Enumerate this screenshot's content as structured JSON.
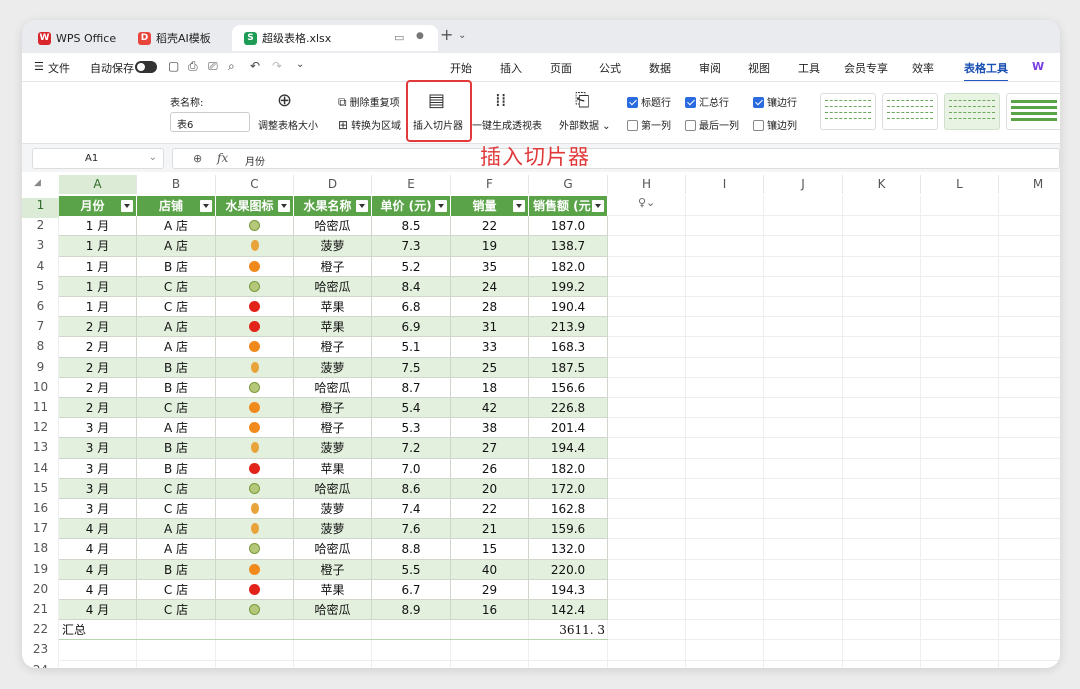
{
  "window_tabs": [
    {
      "label": "WPS Office",
      "icon": "wps-logo-icon",
      "color": "#d9262c"
    },
    {
      "label": "稻壳AI模板",
      "icon": "docer-logo-icon",
      "color": "#e8453c"
    },
    {
      "label": "超级表格.xlsx",
      "icon": "spreadsheet-icon",
      "color": "#1e9c56"
    }
  ],
  "menu": {
    "file": "文件",
    "autosave": "自动保存",
    "tabs": [
      "开始",
      "插入",
      "页面",
      "公式",
      "数据",
      "审阅",
      "视图",
      "工具",
      "会员专享",
      "效率",
      "表格工具",
      "W"
    ]
  },
  "ribbon": {
    "table_name_label": "表名称:",
    "table_name_value": "表6",
    "resize_table": "调整表格大小",
    "remove_duplicates": "删除重复项",
    "convert_to_range": "转换为区域",
    "insert_slicer": "插入切片器",
    "pivot": "一键生成透视表",
    "external_data": "外部数据",
    "options": {
      "header_row": "标题行",
      "total_row": "汇总行",
      "banded_rows": "镶边行",
      "first_col": "第一列",
      "last_col": "最后一列",
      "banded_cols": "镶边列"
    }
  },
  "formula_bar": {
    "cell_ref": "A1",
    "fx": "fx",
    "content": "月份"
  },
  "callout": "插入切片器",
  "columns": [
    "A",
    "B",
    "C",
    "D",
    "E",
    "F",
    "G",
    "H",
    "I",
    "J",
    "K",
    "L",
    "M"
  ],
  "headers": [
    "月份",
    "店铺",
    "水果图标",
    "水果名称",
    "单价 (元)",
    "销量",
    "销售额 (元)"
  ],
  "rows": [
    {
      "month": "1 月",
      "store": "A 店",
      "fruit_icon": "melon",
      "fruit": "哈密瓜",
      "price": "8.5",
      "qty": "22",
      "sales": "187.0"
    },
    {
      "month": "1 月",
      "store": "A 店",
      "fruit_icon": "pineapple",
      "fruit": "菠萝",
      "price": "7.3",
      "qty": "19",
      "sales": "138.7"
    },
    {
      "month": "1 月",
      "store": "B 店",
      "fruit_icon": "orange",
      "fruit": "橙子",
      "price": "5.2",
      "qty": "35",
      "sales": "182.0"
    },
    {
      "month": "1 月",
      "store": "C 店",
      "fruit_icon": "melon",
      "fruit": "哈密瓜",
      "price": "8.4",
      "qty": "24",
      "sales": "199.2"
    },
    {
      "month": "1 月",
      "store": "C 店",
      "fruit_icon": "apple",
      "fruit": "苹果",
      "price": "6.8",
      "qty": "28",
      "sales": "190.4"
    },
    {
      "month": "2 月",
      "store": "A 店",
      "fruit_icon": "apple",
      "fruit": "苹果",
      "price": "6.9",
      "qty": "31",
      "sales": "213.9"
    },
    {
      "month": "2 月",
      "store": "A 店",
      "fruit_icon": "orange",
      "fruit": "橙子",
      "price": "5.1",
      "qty": "33",
      "sales": "168.3"
    },
    {
      "month": "2 月",
      "store": "B 店",
      "fruit_icon": "pineapple",
      "fruit": "菠萝",
      "price": "7.5",
      "qty": "25",
      "sales": "187.5"
    },
    {
      "month": "2 月",
      "store": "B 店",
      "fruit_icon": "melon",
      "fruit": "哈密瓜",
      "price": "8.7",
      "qty": "18",
      "sales": "156.6"
    },
    {
      "month": "2 月",
      "store": "C 店",
      "fruit_icon": "orange",
      "fruit": "橙子",
      "price": "5.4",
      "qty": "42",
      "sales": "226.8"
    },
    {
      "month": "3 月",
      "store": "A 店",
      "fruit_icon": "orange",
      "fruit": "橙子",
      "price": "5.3",
      "qty": "38",
      "sales": "201.4"
    },
    {
      "month": "3 月",
      "store": "B 店",
      "fruit_icon": "pineapple",
      "fruit": "菠萝",
      "price": "7.2",
      "qty": "27",
      "sales": "194.4"
    },
    {
      "month": "3 月",
      "store": "B 店",
      "fruit_icon": "apple",
      "fruit": "苹果",
      "price": "7.0",
      "qty": "26",
      "sales": "182.0"
    },
    {
      "month": "3 月",
      "store": "C 店",
      "fruit_icon": "melon",
      "fruit": "哈密瓜",
      "price": "8.6",
      "qty": "20",
      "sales": "172.0"
    },
    {
      "month": "3 月",
      "store": "C 店",
      "fruit_icon": "pineapple",
      "fruit": "菠萝",
      "price": "7.4",
      "qty": "22",
      "sales": "162.8"
    },
    {
      "month": "4 月",
      "store": "A 店",
      "fruit_icon": "pineapple",
      "fruit": "菠萝",
      "price": "7.6",
      "qty": "21",
      "sales": "159.6"
    },
    {
      "month": "4 月",
      "store": "A 店",
      "fruit_icon": "melon",
      "fruit": "哈密瓜",
      "price": "8.8",
      "qty": "15",
      "sales": "132.0"
    },
    {
      "month": "4 月",
      "store": "B 店",
      "fruit_icon": "orange",
      "fruit": "橙子",
      "price": "5.5",
      "qty": "40",
      "sales": "220.0"
    },
    {
      "month": "4 月",
      "store": "C 店",
      "fruit_icon": "apple",
      "fruit": "苹果",
      "price": "6.7",
      "qty": "29",
      "sales": "194.3"
    },
    {
      "month": "4 月",
      "store": "C 店",
      "fruit_icon": "melon",
      "fruit": "哈密瓜",
      "price": "8.9",
      "qty": "16",
      "sales": "142.4"
    }
  ],
  "total_row": {
    "label": "汇总",
    "value": "3611. 3"
  },
  "fruit_colors": {
    "melon": "#b5c87a",
    "pineapple": "#e8a33a",
    "orange": "#f08a1c",
    "apple": "#e2231a"
  },
  "accent_color": "#5aa348",
  "band_color": "#e3f0dd"
}
